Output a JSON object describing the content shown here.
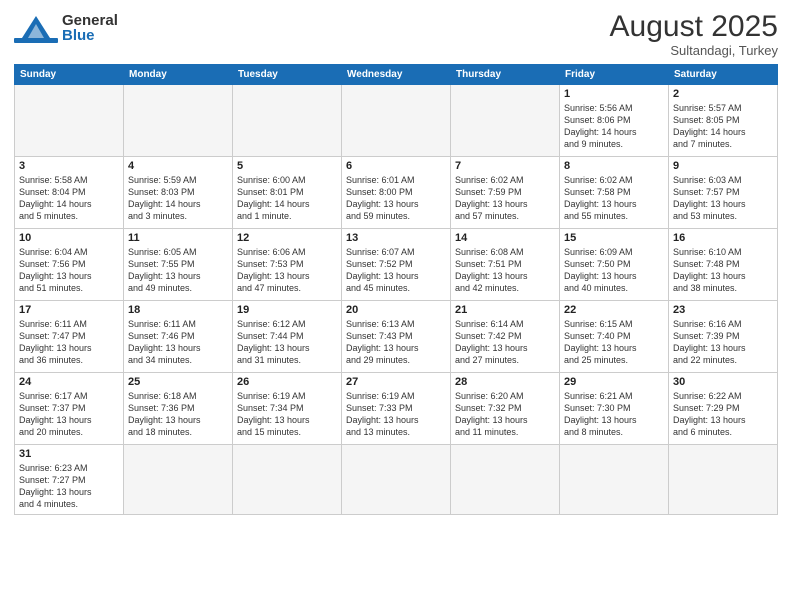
{
  "header": {
    "logo_general": "General",
    "logo_blue": "Blue",
    "month_title": "August 2025",
    "subtitle": "Sultandagi, Turkey"
  },
  "weekdays": [
    "Sunday",
    "Monday",
    "Tuesday",
    "Wednesday",
    "Thursday",
    "Friday",
    "Saturday"
  ],
  "weeks": [
    [
      {
        "day": "",
        "info": ""
      },
      {
        "day": "",
        "info": ""
      },
      {
        "day": "",
        "info": ""
      },
      {
        "day": "",
        "info": ""
      },
      {
        "day": "",
        "info": ""
      },
      {
        "day": "1",
        "info": "Sunrise: 5:56 AM\nSunset: 8:06 PM\nDaylight: 14 hours\nand 9 minutes."
      },
      {
        "day": "2",
        "info": "Sunrise: 5:57 AM\nSunset: 8:05 PM\nDaylight: 14 hours\nand 7 minutes."
      }
    ],
    [
      {
        "day": "3",
        "info": "Sunrise: 5:58 AM\nSunset: 8:04 PM\nDaylight: 14 hours\nand 5 minutes."
      },
      {
        "day": "4",
        "info": "Sunrise: 5:59 AM\nSunset: 8:03 PM\nDaylight: 14 hours\nand 3 minutes."
      },
      {
        "day": "5",
        "info": "Sunrise: 6:00 AM\nSunset: 8:01 PM\nDaylight: 14 hours\nand 1 minute."
      },
      {
        "day": "6",
        "info": "Sunrise: 6:01 AM\nSunset: 8:00 PM\nDaylight: 13 hours\nand 59 minutes."
      },
      {
        "day": "7",
        "info": "Sunrise: 6:02 AM\nSunset: 7:59 PM\nDaylight: 13 hours\nand 57 minutes."
      },
      {
        "day": "8",
        "info": "Sunrise: 6:02 AM\nSunset: 7:58 PM\nDaylight: 13 hours\nand 55 minutes."
      },
      {
        "day": "9",
        "info": "Sunrise: 6:03 AM\nSunset: 7:57 PM\nDaylight: 13 hours\nand 53 minutes."
      }
    ],
    [
      {
        "day": "10",
        "info": "Sunrise: 6:04 AM\nSunset: 7:56 PM\nDaylight: 13 hours\nand 51 minutes."
      },
      {
        "day": "11",
        "info": "Sunrise: 6:05 AM\nSunset: 7:55 PM\nDaylight: 13 hours\nand 49 minutes."
      },
      {
        "day": "12",
        "info": "Sunrise: 6:06 AM\nSunset: 7:53 PM\nDaylight: 13 hours\nand 47 minutes."
      },
      {
        "day": "13",
        "info": "Sunrise: 6:07 AM\nSunset: 7:52 PM\nDaylight: 13 hours\nand 45 minutes."
      },
      {
        "day": "14",
        "info": "Sunrise: 6:08 AM\nSunset: 7:51 PM\nDaylight: 13 hours\nand 42 minutes."
      },
      {
        "day": "15",
        "info": "Sunrise: 6:09 AM\nSunset: 7:50 PM\nDaylight: 13 hours\nand 40 minutes."
      },
      {
        "day": "16",
        "info": "Sunrise: 6:10 AM\nSunset: 7:48 PM\nDaylight: 13 hours\nand 38 minutes."
      }
    ],
    [
      {
        "day": "17",
        "info": "Sunrise: 6:11 AM\nSunset: 7:47 PM\nDaylight: 13 hours\nand 36 minutes."
      },
      {
        "day": "18",
        "info": "Sunrise: 6:11 AM\nSunset: 7:46 PM\nDaylight: 13 hours\nand 34 minutes."
      },
      {
        "day": "19",
        "info": "Sunrise: 6:12 AM\nSunset: 7:44 PM\nDaylight: 13 hours\nand 31 minutes."
      },
      {
        "day": "20",
        "info": "Sunrise: 6:13 AM\nSunset: 7:43 PM\nDaylight: 13 hours\nand 29 minutes."
      },
      {
        "day": "21",
        "info": "Sunrise: 6:14 AM\nSunset: 7:42 PM\nDaylight: 13 hours\nand 27 minutes."
      },
      {
        "day": "22",
        "info": "Sunrise: 6:15 AM\nSunset: 7:40 PM\nDaylight: 13 hours\nand 25 minutes."
      },
      {
        "day": "23",
        "info": "Sunrise: 6:16 AM\nSunset: 7:39 PM\nDaylight: 13 hours\nand 22 minutes."
      }
    ],
    [
      {
        "day": "24",
        "info": "Sunrise: 6:17 AM\nSunset: 7:37 PM\nDaylight: 13 hours\nand 20 minutes."
      },
      {
        "day": "25",
        "info": "Sunrise: 6:18 AM\nSunset: 7:36 PM\nDaylight: 13 hours\nand 18 minutes."
      },
      {
        "day": "26",
        "info": "Sunrise: 6:19 AM\nSunset: 7:34 PM\nDaylight: 13 hours\nand 15 minutes."
      },
      {
        "day": "27",
        "info": "Sunrise: 6:19 AM\nSunset: 7:33 PM\nDaylight: 13 hours\nand 13 minutes."
      },
      {
        "day": "28",
        "info": "Sunrise: 6:20 AM\nSunset: 7:32 PM\nDaylight: 13 hours\nand 11 minutes."
      },
      {
        "day": "29",
        "info": "Sunrise: 6:21 AM\nSunset: 7:30 PM\nDaylight: 13 hours\nand 8 minutes."
      },
      {
        "day": "30",
        "info": "Sunrise: 6:22 AM\nSunset: 7:29 PM\nDaylight: 13 hours\nand 6 minutes."
      }
    ],
    [
      {
        "day": "31",
        "info": "Sunrise: 6:23 AM\nSunset: 7:27 PM\nDaylight: 13 hours\nand 4 minutes."
      },
      {
        "day": "",
        "info": ""
      },
      {
        "day": "",
        "info": ""
      },
      {
        "day": "",
        "info": ""
      },
      {
        "day": "",
        "info": ""
      },
      {
        "day": "",
        "info": ""
      },
      {
        "day": "",
        "info": ""
      }
    ]
  ]
}
